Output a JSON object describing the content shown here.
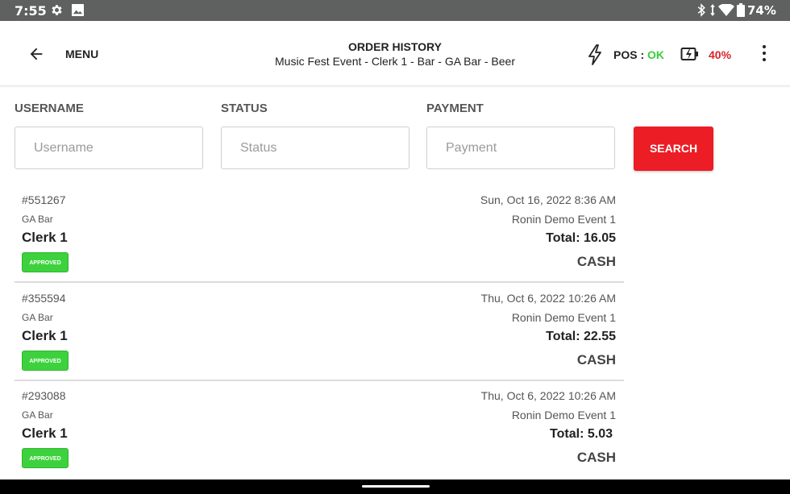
{
  "status_bar": {
    "time": "7:55",
    "battery_percent": "74%",
    "icons": [
      "settings-icon",
      "image-icon",
      "bluetooth-icon",
      "data-arrows-icon",
      "wifi-icon",
      "battery-icon"
    ]
  },
  "app_bar": {
    "back_icon": "arrow-left-icon",
    "menu_label": "MENU",
    "title": "ORDER HISTORY",
    "subtitle": "Music Fest Event - Clerk 1 - Bar - GA Bar - Beer",
    "pos_label": "POS : ",
    "pos_status": "OK",
    "battery_level": "40%",
    "more_icon": "more-vert-icon"
  },
  "colors": {
    "status_bar": "#5f6161",
    "ok_green": "#3bcc3b",
    "alert_red": "#d8232a",
    "search_button": "#ec1d24",
    "approved_badge": "#3dd23d"
  },
  "filters": {
    "username": {
      "label": "USERNAME",
      "placeholder": "Username",
      "value": ""
    },
    "status": {
      "label": "STATUS",
      "placeholder": "Status",
      "value": ""
    },
    "payment": {
      "label": "PAYMENT",
      "placeholder": "Payment",
      "value": ""
    },
    "search_label": "SEARCH"
  },
  "orders": [
    {
      "id": "#551267",
      "location": "GA Bar",
      "clerk": "Clerk 1",
      "status": "APPROVED",
      "date": "Sun, Oct 16, 2022 8:36 AM",
      "event": "Ronin Demo Event 1",
      "total": "Total: 16.05",
      "payment": "CASH"
    },
    {
      "id": "#355594",
      "location": "GA Bar",
      "clerk": "Clerk 1",
      "status": "APPROVED",
      "date": "Thu, Oct 6, 2022 10:26 AM",
      "event": "Ronin Demo Event 1",
      "total": "Total: 22.55",
      "payment": "CASH"
    },
    {
      "id": "#293088",
      "location": "GA Bar",
      "clerk": "Clerk 1",
      "status": "APPROVED",
      "date": "Thu, Oct 6, 2022 10:26 AM",
      "event": "Ronin Demo Event 1",
      "total": "Total: 5.03",
      "payment": "CASH"
    }
  ]
}
